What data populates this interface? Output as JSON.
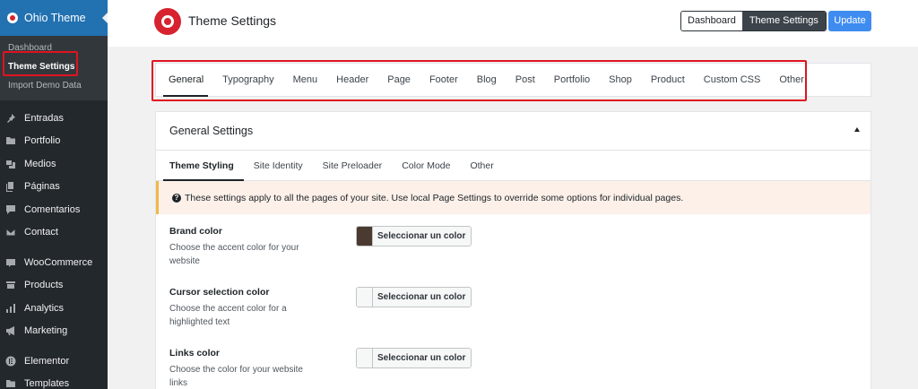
{
  "sidebar": {
    "app_title": "Ohio Theme",
    "submenu": [
      {
        "label": "Dashboard",
        "active": false
      },
      {
        "label": "Theme Settings",
        "active": true
      },
      {
        "label": "Import Demo Data",
        "active": false
      }
    ],
    "menu": [
      {
        "label": "Entradas",
        "icon": "pin-icon"
      },
      {
        "label": "Portfolio",
        "icon": "folder-icon"
      },
      {
        "label": "Medios",
        "icon": "media-icon"
      },
      {
        "label": "Páginas",
        "icon": "pages-icon"
      },
      {
        "label": "Comentarios",
        "icon": "comment-icon"
      },
      {
        "label": "Contact",
        "icon": "mail-icon"
      },
      {
        "label": "WooCommerce",
        "icon": "woo-icon"
      },
      {
        "label": "Products",
        "icon": "archive-icon"
      },
      {
        "label": "Analytics",
        "icon": "bar-chart-icon"
      },
      {
        "label": "Marketing",
        "icon": "megaphone-icon"
      },
      {
        "label": "Elementor",
        "icon": "elementor-icon"
      },
      {
        "label": "Templates",
        "icon": "folder-icon"
      }
    ]
  },
  "header": {
    "title": "Theme Settings",
    "toggle": {
      "dashboard": "Dashboard",
      "theme_settings": "Theme Settings"
    },
    "update_label": "Update"
  },
  "tabs": [
    "General",
    "Typography",
    "Menu",
    "Header",
    "Page",
    "Footer",
    "Blog",
    "Post",
    "Portfolio",
    "Shop",
    "Product",
    "Custom CSS",
    "Other"
  ],
  "active_tab": "General",
  "section": {
    "title": "General Settings",
    "subtabs": [
      "Theme Styling",
      "Site Identity",
      "Site Preloader",
      "Color Mode",
      "Other"
    ],
    "notice": "These settings apply to all the pages of your site. Use local Page Settings to override some options for individual pages.",
    "settings": [
      {
        "label": "Brand color",
        "description": "Choose the accent color for your website",
        "button": "Seleccionar un color",
        "color": "#4b3a30"
      },
      {
        "label": "Cursor selection color",
        "description": "Choose the accent color for a highlighted text",
        "button": "Seleccionar un color",
        "color": ""
      },
      {
        "label": "Links color",
        "description": "Choose the color for your website links",
        "button": "Seleccionar un color",
        "color": ""
      }
    ]
  },
  "colors": {
    "accent": "#2271b1",
    "brand_red": "#d6232f",
    "highlight": "#e0131f",
    "update": "#3f8cf1"
  }
}
